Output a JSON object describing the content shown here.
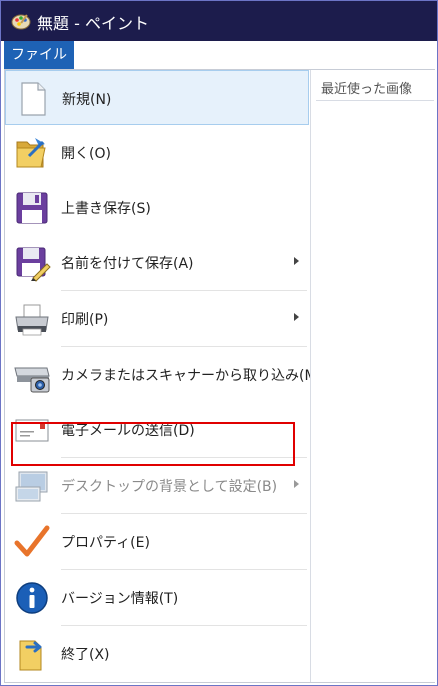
{
  "window": {
    "title": "無題 - ペイント"
  },
  "menubar": {
    "file_tab": "ファイル"
  },
  "recent": {
    "title": "最近使った画像"
  },
  "menu": {
    "items": [
      {
        "label": "新規(N)",
        "icon": "new-document-icon"
      },
      {
        "label": "開く(O)",
        "icon": "open-folder-icon"
      },
      {
        "label": "上書き保存(S)",
        "icon": "save-icon"
      },
      {
        "label": "名前を付けて保存(A)",
        "icon": "save-as-icon"
      },
      {
        "label": "印刷(P)",
        "icon": "printer-icon"
      },
      {
        "label": "カメラまたはスキャナーから取り込み(M)",
        "icon": "camera-scanner-icon"
      },
      {
        "label": "電子メールの送信(D)",
        "icon": "email-icon"
      },
      {
        "label": "デスクトップの背景として設定(B)",
        "icon": "desktop-background-icon"
      },
      {
        "label": "プロパティ(E)",
        "icon": "checkmark-icon"
      },
      {
        "label": "バージョン情報(T)",
        "icon": "info-icon"
      },
      {
        "label": "終了(X)",
        "icon": "exit-icon"
      }
    ]
  },
  "colors": {
    "titlebar": "#1c1c4c",
    "file_tab": "#1e62b5",
    "highlight": "#e00000"
  }
}
